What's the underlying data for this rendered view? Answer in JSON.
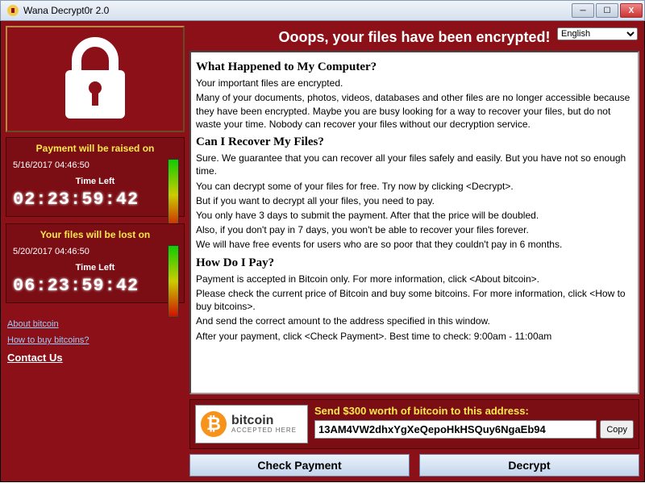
{
  "window": {
    "title": "Wana Decrypt0r 2.0"
  },
  "header": {
    "ooops": "Ooops, your files have been encrypted!",
    "language": "English"
  },
  "timer1": {
    "heading": "Payment will be raised on",
    "datetime": "5/16/2017 04:46:50",
    "time_left_label": "Time Left",
    "digits": "02:23:59:42"
  },
  "timer2": {
    "heading": "Your files will be lost on",
    "datetime": "5/20/2017 04:46:50",
    "time_left_label": "Time Left",
    "digits": "06:23:59:42"
  },
  "links": {
    "about_bitcoin": "About bitcoin",
    "how_to_buy": "How to buy bitcoins?",
    "contact_us": "Contact Us"
  },
  "body": {
    "h1": "What Happened to My Computer?",
    "p1a": "Your important files are encrypted.",
    "p1b": "Many of your documents, photos, videos, databases and other files are no longer accessible because they have been encrypted. Maybe you are busy looking for a way to recover your files, but do not waste your time. Nobody can recover your files without our decryption service.",
    "h2": "Can I Recover My Files?",
    "p2a": "Sure. We guarantee that you can recover all your files safely and easily. But you have not so enough time.",
    "p2b": "You can decrypt some of your files for free. Try now by clicking <Decrypt>.",
    "p2c": "But if you want to decrypt all your files, you need to pay.",
    "p2d": "You only have 3 days to submit the payment. After that the price will be doubled.",
    "p2e": "Also, if you don't pay in 7 days, you won't be able to recover your files forever.",
    "p2f": "We will have free events for users who are so poor that they couldn't pay in 6 months.",
    "h3": "How Do I Pay?",
    "p3a": "Payment is accepted in Bitcoin only. For more information, click <About bitcoin>.",
    "p3b": "Please check the current price of Bitcoin and buy some bitcoins. For more information, click <How to buy bitcoins>.",
    "p3c": "And send the correct amount to the address specified in this window.",
    "p3d": "After your payment, click <Check Payment>. Best time to check: 9:00am - 11:00am"
  },
  "payment": {
    "bitcoin_label": "bitcoin",
    "accepted_here": "ACCEPTED HERE",
    "send_label": "Send $300 worth of bitcoin to this address:",
    "address": "13AM4VW2dhxYgXeQepoHkHSQuy6NgaEb94",
    "copy": "Copy"
  },
  "buttons": {
    "check_payment": "Check Payment",
    "decrypt": "Decrypt"
  }
}
